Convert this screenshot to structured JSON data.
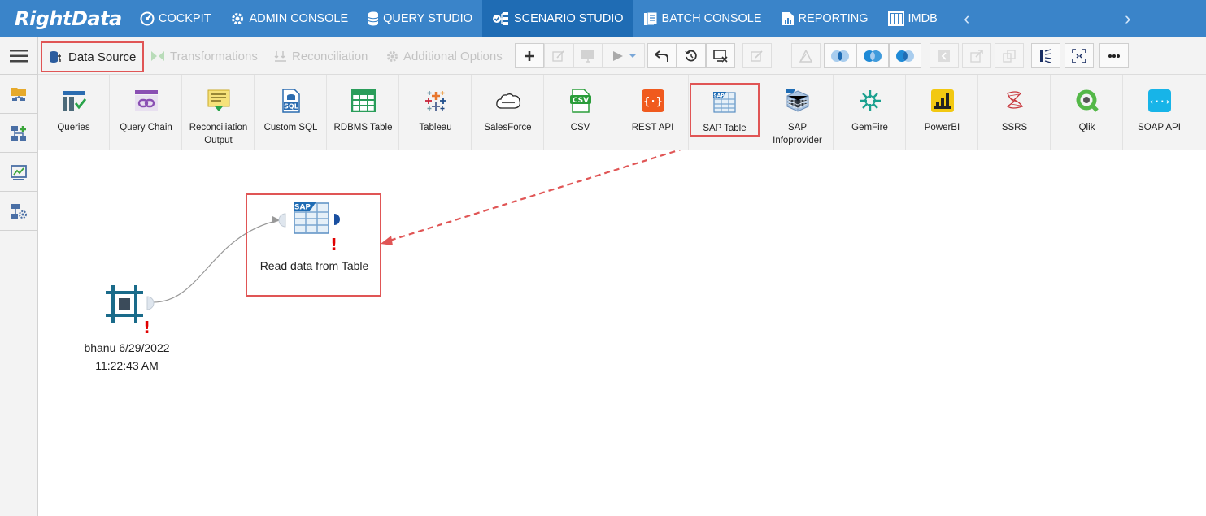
{
  "app": {
    "logo_text": "RightData"
  },
  "topnav": {
    "items": [
      {
        "label": "COCKPIT",
        "icon": "gauge-icon"
      },
      {
        "label": "ADMIN CONSOLE",
        "icon": "gear-icon"
      },
      {
        "label": "QUERY STUDIO",
        "icon": "database-icon"
      },
      {
        "label": "SCENARIO STUDIO",
        "icon": "flow-icon",
        "active": true
      },
      {
        "label": "BATCH CONSOLE",
        "icon": "batch-icon"
      },
      {
        "label": "REPORTING",
        "icon": "report-icon"
      },
      {
        "label": "IMDB",
        "icon": "columns-icon"
      }
    ],
    "arrow_left": "‹",
    "arrow_right": "›"
  },
  "toolbar": {
    "tabs": [
      {
        "label": "Data Source",
        "active": true
      },
      {
        "label": "Transformations"
      },
      {
        "label": "Reconciliation"
      },
      {
        "label": "Additional Options"
      }
    ]
  },
  "palette": {
    "items": [
      {
        "label": "Queries",
        "icon": "queries-icon"
      },
      {
        "label": "Query Chain",
        "icon": "query-chain-icon"
      },
      {
        "label": "Reconciliation Output",
        "icon": "reconciliation-output-icon"
      },
      {
        "label": "Custom SQL",
        "icon": "sql-file-icon"
      },
      {
        "label": "RDBMS Table",
        "icon": "table-grid-icon"
      },
      {
        "label": "Tableau",
        "icon": "tableau-icon"
      },
      {
        "label": "SalesForce",
        "icon": "salesforce-cloud-icon"
      },
      {
        "label": "CSV",
        "icon": "csv-icon"
      },
      {
        "label": "REST API",
        "icon": "rest-api-icon"
      },
      {
        "label": "SAP Table",
        "icon": "sap-table-icon",
        "highlight": true
      },
      {
        "label": "SAP Infoprovider",
        "icon": "sap-cube-icon"
      },
      {
        "label": "GemFire",
        "icon": "gemfire-icon"
      },
      {
        "label": "PowerBI",
        "icon": "powerbi-icon"
      },
      {
        "label": "SSRS",
        "icon": "ssrs-icon"
      },
      {
        "label": "Qlik",
        "icon": "qlik-icon"
      },
      {
        "label": "SOAP API",
        "icon": "soap-api-icon"
      }
    ]
  },
  "canvas": {
    "nodes": [
      {
        "label_line1": "bhanu 6/29/2022",
        "label_line2": "11:22:43 AM",
        "warning": "!"
      },
      {
        "label": "Read data from Table",
        "warning": "!"
      }
    ],
    "sap_text": "SAP"
  },
  "colors": {
    "nav": "#3a84c9",
    "nav_active": "#1f6cb4",
    "highlight": "#e05555",
    "warning": "#e00000"
  }
}
